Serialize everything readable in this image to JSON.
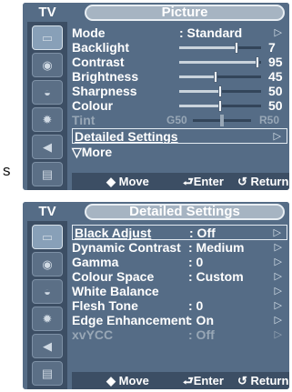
{
  "side_label": "s",
  "picture": {
    "tv_label": "TV",
    "title": "Picture",
    "rows": [
      {
        "label": "Mode",
        "value": ": Standard"
      },
      {
        "label": "Backlight",
        "value": "7",
        "level": 0.7
      },
      {
        "label": "Contrast",
        "value": "95",
        "level": 0.95
      },
      {
        "label": "Brightness",
        "value": "45",
        "level": 0.45
      },
      {
        "label": "Sharpness",
        "value": "50",
        "level": 0.5
      },
      {
        "label": "Colour",
        "value": "50",
        "level": 0.5
      },
      {
        "label": "Tint",
        "g": "G50",
        "r": "R50"
      },
      {
        "label": "Detailed Settings"
      },
      {
        "label": "▽More"
      }
    ],
    "bottom": {
      "move": "◆ Move",
      "enter": "⮐Enter",
      "ret": "↺ Return"
    }
  },
  "detailed": {
    "tv_label": "TV",
    "title": "Detailed Settings",
    "rows": [
      {
        "label": "Black Adjust",
        "value": ": Off"
      },
      {
        "label": "Dynamic Contrast",
        "value": ": Medium"
      },
      {
        "label": "Gamma",
        "value": ": 0"
      },
      {
        "label": "Colour Space",
        "value": ": Custom"
      },
      {
        "label": "White Balance",
        "value": ""
      },
      {
        "label": "Flesh Tone",
        "value": ": 0"
      },
      {
        "label": "Edge Enhancement",
        "value": ": On"
      },
      {
        "label": "xvYCC",
        "value": ": Off"
      }
    ],
    "bottom": {
      "move": "◆ Move",
      "enter": "⮐Enter",
      "ret": "↺ Return"
    }
  },
  "arrow": "▷",
  "icons": [
    "picture-icon",
    "sound-icon",
    "channel-icon",
    "setup-icon",
    "input-icon",
    "application-icon"
  ]
}
